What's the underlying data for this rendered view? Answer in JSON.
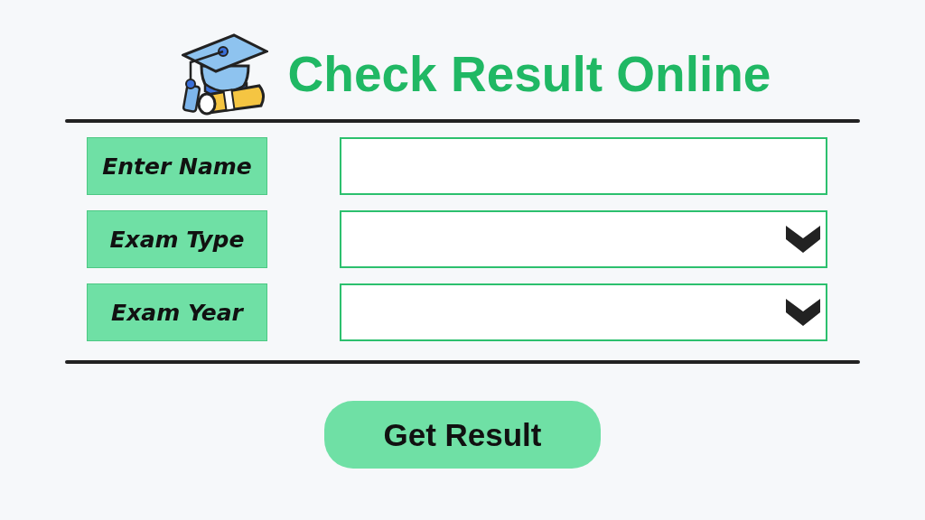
{
  "header": {
    "title": "Check Result Online"
  },
  "fields": [
    {
      "label": "Enter Name",
      "kind": "text"
    },
    {
      "label": "Exam Type",
      "kind": "select"
    },
    {
      "label": "Exam Year",
      "kind": "select"
    }
  ],
  "submit_button": {
    "label": "Get Result"
  }
}
